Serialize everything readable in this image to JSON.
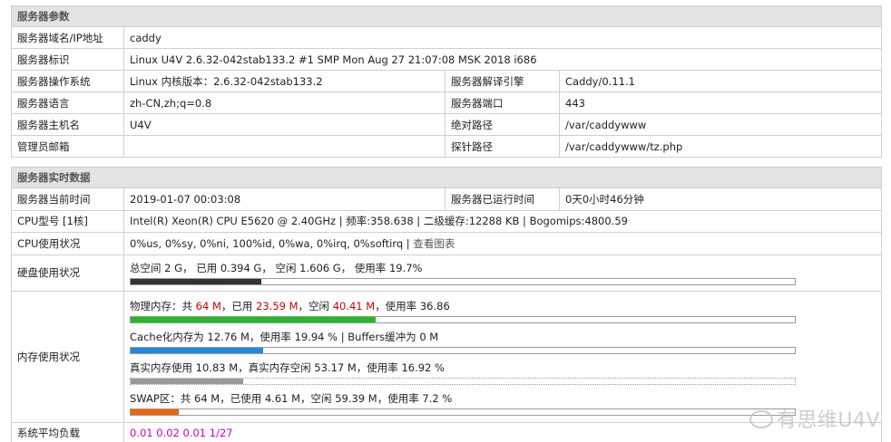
{
  "server_params": {
    "header": "服务器参数",
    "domain_label": "服务器域名/IP地址",
    "domain_value": "caddy",
    "id_label": "服务器标识",
    "id_value": "Linux U4V 2.6.32-042stab133.2 #1 SMP Mon Aug 27 21:07:08 MSK 2018 i686",
    "os_label": "服务器操作系统",
    "os_value": "Linux  内核版本：2.6.32-042stab133.2",
    "engine_label": "服务器解译引擎",
    "engine_value": "Caddy/0.11.1",
    "lang_label": "服务器语言",
    "lang_value": "zh-CN,zh;q=0.8",
    "port_label": "服务器端口",
    "port_value": "443",
    "host_label": "服务器主机名",
    "host_value": "U4V",
    "abspath_label": "绝对路径",
    "abspath_value": "/var/caddywww",
    "admin_label": "管理员邮箱",
    "admin_value": "",
    "probe_label": "探针路径",
    "probe_value": "/var/caddywww/tz.php"
  },
  "realtime": {
    "header": "服务器实时数据",
    "time_label": "服务器当前时间",
    "time_value": "2019-01-07 00:03:08",
    "uptime_label": "服务器已运行时间",
    "uptime_value": "0天0小时46分钟",
    "cpu_model_label": "CPU型号 [1核]",
    "cpu_model_value": "Intel(R) Xeon(R) CPU E5620 @ 2.40GHz | 频率:358.638 | 二级缓存:12288 KB | Bogomips:4800.59",
    "cpu_usage_label": "CPU使用状况",
    "cpu_usage_value": "0%us, 0%sy, 0%ni, 100%id, 0%wa, 0%irq, 0%softirq | ",
    "cpu_chart_link": "查看图表",
    "disk_label": "硬盘使用状况",
    "disk_text": "总空间 2 G， 已用 0.394 G， 空闲 1.606 G， 使用率 19.7%",
    "disk_usage_pct": 19.7,
    "mem_label": "内存使用状况",
    "phys_prefix": "物理内存：共 ",
    "phys_total": "64 M",
    "phys_used_prefix": "，已用 ",
    "phys_used": "23.59 M",
    "phys_free_prefix": "，空闲 ",
    "phys_free": "40.41 M",
    "phys_rate": "，使用率 36.86",
    "phys_usage_pct": 36.86,
    "cache_text": "Cache化内存为 12.76 M，使用率 19.94 % | Buffers缓冲为 0 M",
    "cache_usage_pct": 19.94,
    "real_text": "真实内存使用 10.83 M，真实内存空闲 53.17 M，使用率 16.92 %",
    "real_usage_pct": 16.92,
    "swap_text": "SWAP区：共 64 M，已使用 4.61 M，空闲 59.39 M，使用率 7.2 %",
    "swap_usage_pct": 7.2,
    "load_label": "系统平均负载",
    "load_value": "0.01 0.02 0.01 1/27"
  },
  "watermark": "有思维U4V",
  "colors": {
    "header_bg": "#e3e3e3",
    "red_value": "#cc0000",
    "load_value": "#cc00cc",
    "bar_disk": "#333333",
    "bar_phys": "#22bb22",
    "bar_cache": "#1e88e5",
    "bar_real": "#999999",
    "bar_swap": "#ee6600"
  }
}
